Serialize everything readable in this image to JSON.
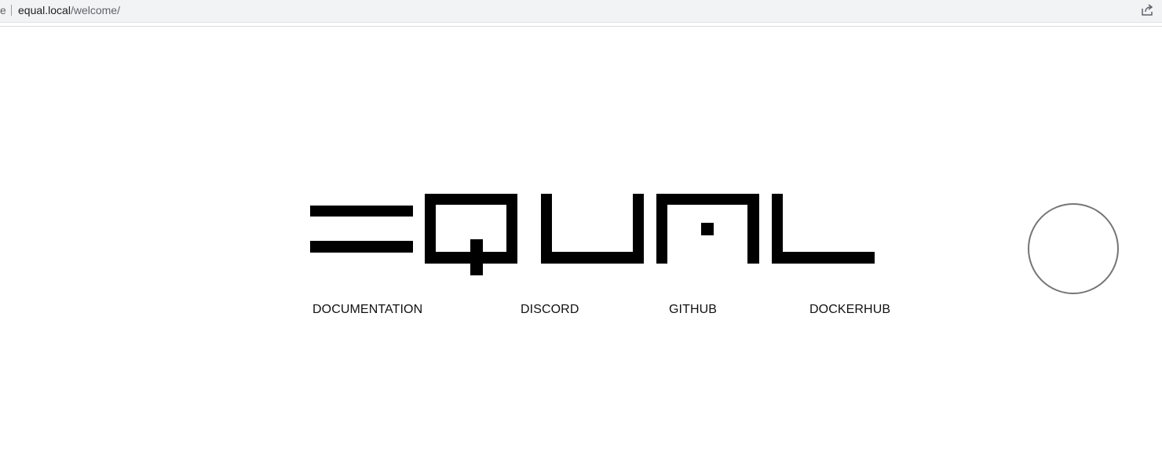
{
  "browser": {
    "left_fragment": "e",
    "url_host": "equal.local",
    "url_path": "/welcome/",
    "share_icon": "share-icon"
  },
  "logo": {
    "text": "EQUAL"
  },
  "nav": {
    "documentation": "DOCUMENTATION",
    "discord": "DISCORD",
    "github": "GITHUB",
    "dockerhub": "DOCKERHUB"
  },
  "decor": {
    "circle": "outline circle",
    "circle_color": "#757575"
  }
}
